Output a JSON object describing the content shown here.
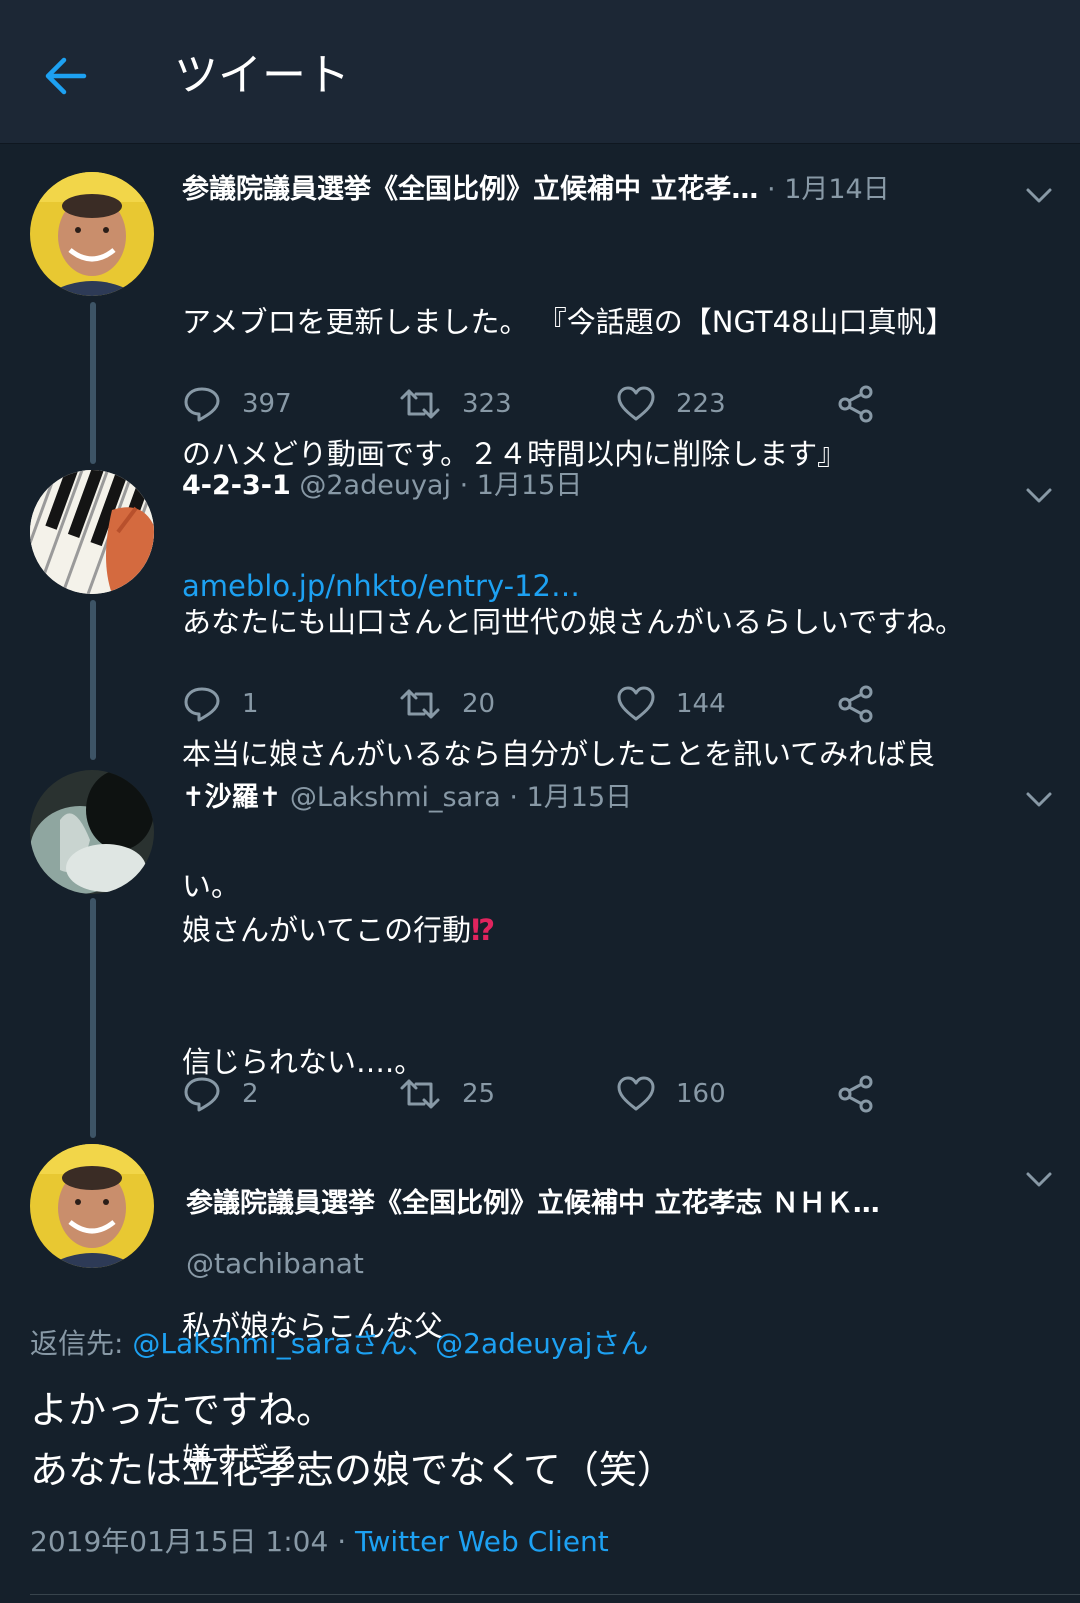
{
  "header": {
    "title": "ツイート",
    "back_icon": "arrow-left-icon",
    "accent": "#1da1f2"
  },
  "tweets": [
    {
      "name": "参議院議員選挙《全国比例》立候補中 立花孝…",
      "handle": "",
      "dot": "·",
      "date": "1月14日",
      "lines": [
        "アメブロを更新しました。 『今話題の【NGT48山口真帆】",
        "のハメどり動画です。２４時間以内に削除します』"
      ],
      "link": "ameblo.jp/nhkto/entry-12…",
      "replies": "397",
      "retweets": "323",
      "likes": "223"
    },
    {
      "name": "4-2-3-1",
      "handle": "@2adeuyaj",
      "dot": "·",
      "date": "1月15日",
      "lines": [
        "あなたにも山口さんと同世代の娘さんがいるらしいですね。",
        "本当に娘さんがいるなら自分がしたことを訊いてみれば良",
        "い。"
      ],
      "replies": "1",
      "retweets": "20",
      "likes": "144"
    },
    {
      "name": "✝沙羅✝",
      "handle": "@Lakshmi_sara",
      "dot": "·",
      "date": "1月15日",
      "line1": "娘さんがいてこの行動",
      "emoji": "⁉",
      "line2": "信じられない….。",
      "line3": "私が娘ならこんな父",
      "line4": "嫌すぎる。",
      "replies": "2",
      "retweets": "25",
      "likes": "160"
    }
  ],
  "main_tweet": {
    "name": "参議院議員選挙《全国比例》立候補中 立花孝志 ＮＨＫ…",
    "handle": "@tachibanat",
    "replying_prefix": "返信先:",
    "replying_1": "@Lakshmi_saraさん",
    "replying_sep": "、",
    "replying_2": "@2adeuyajさん",
    "line1": "よかったですね。",
    "line2": "あなたは立花孝志の娘でなくて（笑）",
    "timestamp": "2019年01月15日 1:04",
    "dot": "·",
    "client": "Twitter Web Client"
  },
  "icons": {
    "reply": "reply-icon",
    "retweet": "retweet-icon",
    "like": "heart-icon",
    "share": "share-icon",
    "more": "chevron-down-icon"
  }
}
